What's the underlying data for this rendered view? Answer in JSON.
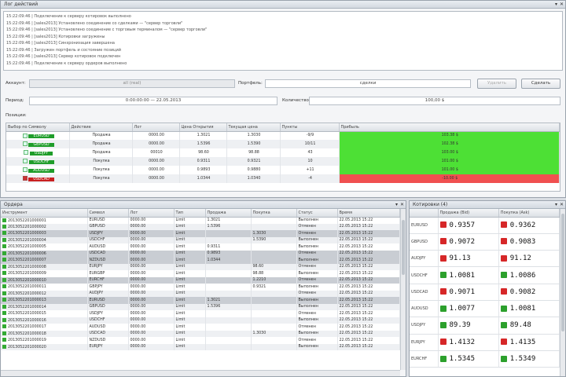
{
  "log_panel": {
    "title": "Лог действий",
    "lines": [
      "15:22:09:46 | Подключение к серверу котировок выполнено",
      "15:22:09:46 | [sales2013] Установлено соединение со сделками — \"сервер торговли\"",
      "15:22:09:46 | [sales2013] Установлено соединение с торговым терминалом — \"сервер торговли\"",
      "15:22:09:46 | [sales2013] Котировки загружены",
      "15:22:09:46 | [sales2013] Синхронизация завершена",
      "15:22:09:46 | Загружен портфель и состояние позиций",
      "15:22:09:46 | [sales2013] Сервер котировок подключен",
      "15:22:09:46 | Подключение к серверу ордеров выполнено"
    ]
  },
  "order_form": {
    "account_label": "Аккаунт:",
    "account_value": "all (real)",
    "portfolio_label": "Портфель:",
    "portfolio_value": "сделки",
    "cancel_button": "Удалить",
    "submit_button": "Сделать",
    "period_label": "Период:",
    "period_value": "0:00:00:00 — 22.05.2013",
    "lots_label": "Количество:",
    "lots_value": "100,00 $"
  },
  "positions": {
    "title": "Позиции:",
    "columns": [
      "Выбор по Символу",
      "Действие",
      "Лот",
      "Цена Открытия",
      "Текущая цена",
      "Пункты",
      "Прибыль"
    ],
    "rows": [
      {
        "symbol": "EURUSD",
        "action": "Продажа",
        "lot": "0000.00",
        "open": "1.3021",
        "current": "1.3030",
        "points": "-9/9",
        "profit": "103.38 $",
        "state": "up"
      },
      {
        "symbol": "GBPUSD",
        "action": "Продажа",
        "lot": "0000.00",
        "open": "1.5396",
        "current": "1.5390",
        "points": "10/11",
        "profit": "102.38 $",
        "state": "up"
      },
      {
        "symbol": "USDJPY",
        "action": "Продажа",
        "lot": "00010",
        "open": "98.60",
        "current": "98.88",
        "points": "43",
        "profit": "103.00 $",
        "state": "up"
      },
      {
        "symbol": "USDCHF",
        "action": "Покупка",
        "lot": "0000.00",
        "open": "0.9311",
        "current": "0.9321",
        "points": "10",
        "profit": "101.00 $",
        "state": "up"
      },
      {
        "symbol": "AUDUSD",
        "action": "Покупка",
        "lot": "0000.00",
        "open": "0.9893",
        "current": "0.9880",
        "points": "+11",
        "profit": "101.00 $",
        "state": "up"
      },
      {
        "symbol": "USDCAD",
        "action": "Покупка",
        "lot": "0000.00",
        "open": "1.0344",
        "current": "1.0340",
        "points": "-4",
        "profit": "-10.00 $",
        "state": "down"
      }
    ]
  },
  "orders_panel": {
    "title": "Ордера",
    "columns": [
      "Инструмент",
      "Символ",
      "Лот",
      "Тип",
      "Продажа",
      "Покупка",
      "Статус",
      "Время"
    ],
    "rows": [
      {
        "id": "2013052201000001",
        "sym": "EURUSD",
        "lot": "0000.00",
        "type": "Limit",
        "sell": "1.3021",
        "buy": "",
        "status": "Выполнен",
        "time": "22.05.2013 15:22"
      },
      {
        "id": "2013052201000002",
        "sym": "GBPUSD",
        "lot": "0000.00",
        "type": "Limit",
        "sell": "1.5396",
        "buy": "",
        "status": "Отменен",
        "time": "22.05.2013 15:22"
      },
      {
        "id": "2013052201000003",
        "sym": "USDJPY",
        "lot": "0000.00",
        "type": "Limit",
        "sell": "",
        "buy": "1.3030",
        "status": "Отменен",
        "time": "22.05.2013 15:22"
      },
      {
        "id": "2013052201000004",
        "sym": "USDCHF",
        "lot": "0000.00",
        "type": "Limit",
        "sell": "",
        "buy": "1.5390",
        "status": "Выполнен",
        "time": "22.05.2013 15:22"
      },
      {
        "id": "2013052201000005",
        "sym": "AUDUSD",
        "lot": "0000.00",
        "type": "Limit",
        "sell": "0.9311",
        "buy": "",
        "status": "Выполнен",
        "time": "22.05.2013 15:22"
      },
      {
        "id": "2013052201000006",
        "sym": "USDCAD",
        "lot": "0000.00",
        "type": "Limit",
        "sell": "0.9893",
        "buy": "",
        "status": "Отменен",
        "time": "22.05.2013 15:22"
      },
      {
        "id": "2013052201000007",
        "sym": "NZDUSD",
        "lot": "0000.00",
        "type": "Limit",
        "sell": "1.0344",
        "buy": "",
        "status": "Выполнен",
        "time": "22.05.2013 15:22"
      },
      {
        "id": "2013052201000008",
        "sym": "EURJPY",
        "lot": "0000.00",
        "type": "Limit",
        "sell": "",
        "buy": "98.60",
        "status": "Отменен",
        "time": "22.05.2013 15:22"
      },
      {
        "id": "2013052201000009",
        "sym": "EURGBP",
        "lot": "0000.00",
        "type": "Limit",
        "sell": "",
        "buy": "98.88",
        "status": "Выполнен",
        "time": "22.05.2013 15:22"
      },
      {
        "id": "2013052201000010",
        "sym": "EURCHF",
        "lot": "0000.00",
        "type": "Limit",
        "sell": "",
        "buy": "1.2210",
        "status": "Отменен",
        "time": "22.05.2013 15:22"
      },
      {
        "id": "2013052201000011",
        "sym": "GBPJPY",
        "lot": "0000.00",
        "type": "Limit",
        "sell": "",
        "buy": "0.9321",
        "status": "Выполнен",
        "time": "22.05.2013 15:22"
      },
      {
        "id": "2013052201000012",
        "sym": "AUDJPY",
        "lot": "0000.00",
        "type": "Limit",
        "sell": "",
        "buy": "",
        "status": "Отменен",
        "time": "22.05.2013 15:22"
      },
      {
        "id": "2013052201000013",
        "sym": "EURUSD",
        "lot": "0000.00",
        "type": "Limit",
        "sell": "1.3021",
        "buy": "",
        "status": "Выполнен",
        "time": "22.05.2013 15:22"
      },
      {
        "id": "2013052201000014",
        "sym": "GBPUSD",
        "lot": "0000.00",
        "type": "Limit",
        "sell": "1.5396",
        "buy": "",
        "status": "Выполнен",
        "time": "22.05.2013 15:22"
      },
      {
        "id": "2013052201000015",
        "sym": "USDJPY",
        "lot": "0000.00",
        "type": "Limit",
        "sell": "",
        "buy": "",
        "status": "Отменен",
        "time": "22.05.2013 15:22"
      },
      {
        "id": "2013052201000016",
        "sym": "USDCHF",
        "lot": "0000.00",
        "type": "Limit",
        "sell": "",
        "buy": "",
        "status": "Выполнен",
        "time": "22.05.2013 15:22"
      },
      {
        "id": "2013052201000017",
        "sym": "AUDUSD",
        "lot": "0000.00",
        "type": "Limit",
        "sell": "",
        "buy": "",
        "status": "Отменен",
        "time": "22.05.2013 15:22"
      },
      {
        "id": "2013052201000018",
        "sym": "USDCAD",
        "lot": "0000.00",
        "type": "Limit",
        "sell": "",
        "buy": "1.3030",
        "status": "Выполнен",
        "time": "22.05.2013 15:22"
      },
      {
        "id": "2013052201000019",
        "sym": "NZDUSD",
        "lot": "0000.00",
        "type": "Limit",
        "sell": "",
        "buy": "",
        "status": "Отменен",
        "time": "22.05.2013 15:22"
      },
      {
        "id": "2013052201000020",
        "sym": "EURJPY",
        "lot": "0000.00",
        "type": "Limit",
        "sell": "",
        "buy": "",
        "status": "Выполнен",
        "time": "22.05.2013 15:22"
      }
    ]
  },
  "quotes_panel": {
    "title": "Котировки (4)",
    "columns": [
      "Продажа (Bid)",
      "Покупка (Ask)"
    ],
    "rows": [
      {
        "sym": "EURUSD",
        "bid": "0.9357",
        "ask": "0.9362",
        "bid_dir": "dn",
        "ask_dir": "dn"
      },
      {
        "sym": "GBPUSD",
        "bid": "0.9072",
        "ask": "0.9083",
        "bid_dir": "dn",
        "ask_dir": "dn"
      },
      {
        "sym": "AUDJPY",
        "bid": "91.13",
        "ask": "91.12",
        "bid_dir": "dn",
        "ask_dir": "dn"
      },
      {
        "sym": "USDCHF",
        "bid": "1.0081",
        "ask": "1.0086",
        "bid_dir": "up",
        "ask_dir": "up"
      },
      {
        "sym": "USDCAD",
        "bid": "0.9071",
        "ask": "0.9082",
        "bid_dir": "dn",
        "ask_dir": "dn"
      },
      {
        "sym": "AUDUSD",
        "bid": "1.0077",
        "ask": "1.0081",
        "bid_dir": "up",
        "ask_dir": "up"
      },
      {
        "sym": "USDJPY",
        "bid": "89.39",
        "ask": "89.48",
        "bid_dir": "up",
        "ask_dir": "up"
      },
      {
        "sym": "EURJPY",
        "bid": "1.4132",
        "ask": "1.4135",
        "bid_dir": "dn",
        "ask_dir": "dn"
      },
      {
        "sym": "EURCHF",
        "bid": "1.5345",
        "ask": "1.5349",
        "bid_dir": "up",
        "ask_dir": "up"
      }
    ]
  }
}
